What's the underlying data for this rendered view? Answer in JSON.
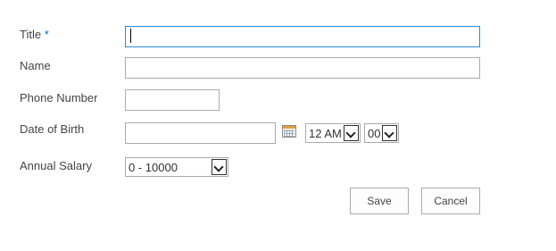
{
  "form": {
    "fields": {
      "title": {
        "label": "Title",
        "required_marker": "*",
        "value": ""
      },
      "name": {
        "label": "Name",
        "value": ""
      },
      "phone": {
        "label": "Phone Number",
        "value": ""
      },
      "dob": {
        "label": "Date of Birth",
        "value": "",
        "hour": "12 AM",
        "minute": "00"
      },
      "salary": {
        "label": "Annual Salary",
        "selected": "0 - 10000"
      }
    },
    "buttons": {
      "save": "Save",
      "cancel": "Cancel"
    }
  },
  "colors": {
    "required": "#0072c6",
    "focus_border": "#2a8dd4",
    "border": "#ababab"
  },
  "icons": {
    "calendar": "calendar-icon",
    "dropdown": "chevron-down-icon"
  }
}
